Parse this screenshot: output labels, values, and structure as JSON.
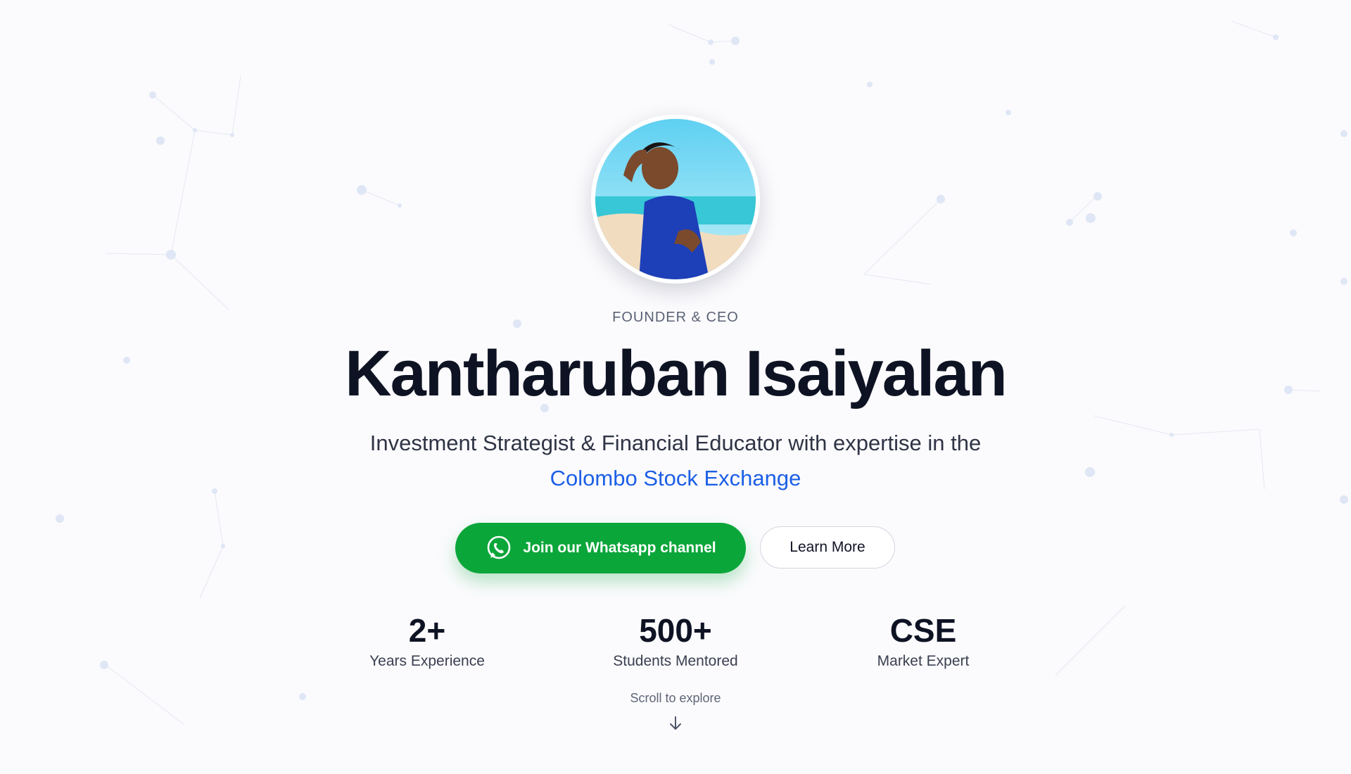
{
  "hero": {
    "role": "FOUNDER & CEO",
    "name": "Kantharuban Isaiyalan",
    "tagline_prefix": "Investment Strategist & Financial Educator with expertise in the",
    "tagline_highlight": "Colombo Stock Exchange"
  },
  "actions": {
    "whatsapp_label": "Join our Whatsapp channel",
    "whatsapp_icon": "whatsapp-icon",
    "learn_more_label": "Learn More"
  },
  "stats": [
    {
      "value": "2+",
      "label": "Years Experience"
    },
    {
      "value": "500+",
      "label": "Students Mentored"
    },
    {
      "value": "CSE",
      "label": "Market Expert"
    }
  ],
  "scroll": {
    "label": "Scroll to explore",
    "icon": "arrow-down-icon"
  },
  "colors": {
    "accent": "#1c5fe6",
    "whatsapp": "#0ba63a",
    "heading": "#0e1324",
    "background": "#fbfbfd"
  }
}
